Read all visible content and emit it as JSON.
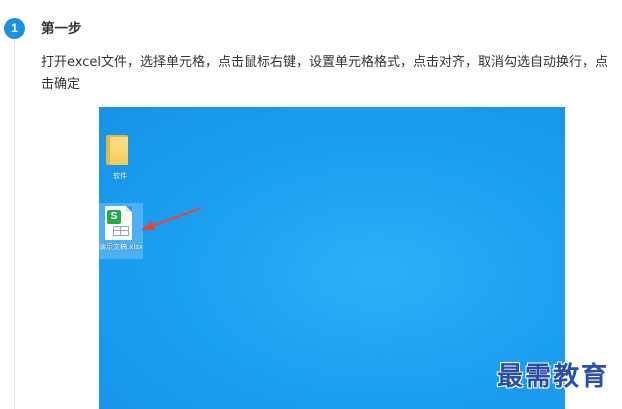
{
  "step": {
    "number": "1",
    "title": "第一步",
    "description": "打开excel文件，选择单元格，点击鼠标右键，设置单元格格式，点击对齐，取消勾选自动换行，点击确定"
  },
  "screenshot": {
    "desktop_background_color": "#1a9ef0",
    "icons": [
      {
        "label": "软件",
        "icon": "folder-icon"
      },
      {
        "label": "演示文稿.xlsx",
        "icon": "spreadsheet-file-icon",
        "badge": "S"
      }
    ],
    "annotation_arrow_color": "#e8453c"
  },
  "watermark": "最需教育"
}
